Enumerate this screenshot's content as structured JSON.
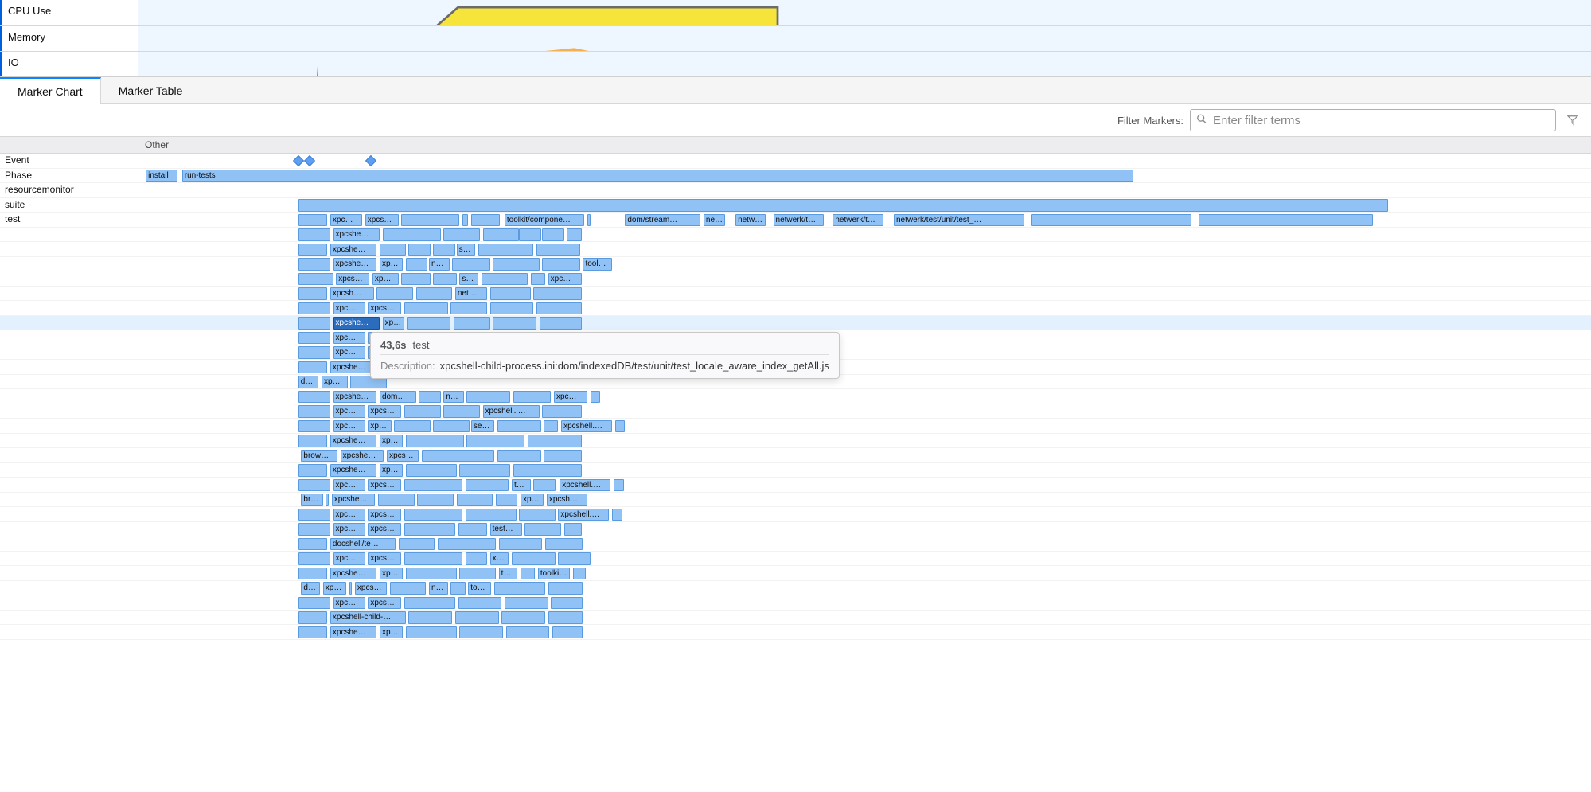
{
  "overview": {
    "tracks": [
      {
        "label": "CPU Use",
        "color_fill": "#f7e43a",
        "color_line": "#6b6b6b"
      },
      {
        "label": "Memory",
        "color_fill": "#f7a93a",
        "color_line": "#d47c00"
      },
      {
        "label": "IO",
        "color_fill": "#e83c5a",
        "color_line": "#c41e3a"
      }
    ]
  },
  "tabs": [
    {
      "label": "Marker Chart",
      "active": true
    },
    {
      "label": "Marker Table",
      "active": false
    }
  ],
  "filter": {
    "label": "Filter Markers:",
    "placeholder": "Enter filter terms"
  },
  "columns": {
    "other": "Other"
  },
  "rows": [
    {
      "label": "Event",
      "kind": "diamonds",
      "diamonds": [
        11.0,
        11.8,
        16.0
      ]
    },
    {
      "label": "Phase",
      "kind": "markers",
      "markers": [
        {
          "l": 0.5,
          "w": 2.2,
          "text": "install"
        },
        {
          "l": 3.0,
          "w": 65.5,
          "text": "run-tests"
        }
      ]
    },
    {
      "label": "resourcemonitor",
      "kind": "markers",
      "markers": []
    },
    {
      "label": "suite",
      "kind": "markers",
      "markers": [
        {
          "l": 11.0,
          "w": 75.0,
          "text": ""
        }
      ]
    },
    {
      "label": "test",
      "kind": "markers",
      "markers": [
        {
          "l": 11.0,
          "w": 2.0,
          "text": ""
        },
        {
          "l": 13.2,
          "w": 2.2,
          "text": "xpc…"
        },
        {
          "l": 15.6,
          "w": 2.3,
          "text": "xpcs…"
        },
        {
          "l": 18.1,
          "w": 4.0,
          "text": ""
        },
        {
          "l": 22.3,
          "w": 0.4,
          "text": ""
        },
        {
          "l": 22.9,
          "w": 2.0,
          "text": ""
        },
        {
          "l": 25.2,
          "w": 5.5,
          "text": "toolkit/compone…"
        },
        {
          "l": 30.9,
          "w": 0.2,
          "text": ""
        },
        {
          "l": 33.5,
          "w": 5.2,
          "text": "dom/stream…"
        },
        {
          "l": 38.9,
          "w": 1.5,
          "text": "ne…"
        },
        {
          "l": 41.1,
          "w": 2.1,
          "text": "netw…"
        },
        {
          "l": 43.7,
          "w": 3.5,
          "text": "netwerk/t…"
        },
        {
          "l": 47.8,
          "w": 3.5,
          "text": "netwerk/t…"
        },
        {
          "l": 52.0,
          "w": 9.0,
          "text": "netwerk/test/unit/test_…"
        },
        {
          "l": 61.5,
          "w": 11.0,
          "text": ""
        },
        {
          "l": 73.0,
          "w": 12.0,
          "text": ""
        }
      ]
    }
  ],
  "test_stack": [
    [
      {
        "l": 11.0,
        "w": 2.2,
        "text": ""
      },
      {
        "l": 13.4,
        "w": 3.2,
        "text": "xpcshe…"
      },
      {
        "l": 16.8,
        "w": 4.0,
        "text": ""
      },
      {
        "l": 21.0,
        "w": 2.5,
        "text": ""
      },
      {
        "l": 23.7,
        "w": 2.5,
        "text": ""
      },
      {
        "l": 26.2,
        "w": 1.5,
        "text": ""
      },
      {
        "l": 27.8,
        "w": 1.5,
        "text": ""
      },
      {
        "l": 29.5,
        "w": 1.0,
        "text": ""
      }
    ],
    [
      {
        "l": 11.0,
        "w": 2.0,
        "text": ""
      },
      {
        "l": 13.2,
        "w": 3.2,
        "text": "xpcshe…"
      },
      {
        "l": 16.6,
        "w": 1.8,
        "text": ""
      },
      {
        "l": 18.6,
        "w": 1.5,
        "text": ""
      },
      {
        "l": 20.3,
        "w": 1.5,
        "text": ""
      },
      {
        "l": 21.9,
        "w": 1.3,
        "text": "s…"
      },
      {
        "l": 23.4,
        "w": 3.8,
        "text": ""
      },
      {
        "l": 27.4,
        "w": 3.0,
        "text": ""
      }
    ],
    [
      {
        "l": 11.0,
        "w": 2.2,
        "text": ""
      },
      {
        "l": 13.4,
        "w": 3.0,
        "text": "xpcshe…"
      },
      {
        "l": 16.6,
        "w": 1.6,
        "text": "xp…"
      },
      {
        "l": 18.4,
        "w": 1.5,
        "text": ""
      },
      {
        "l": 20.0,
        "w": 1.4,
        "text": "n…"
      },
      {
        "l": 21.6,
        "w": 2.6,
        "text": ""
      },
      {
        "l": 24.4,
        "w": 3.2,
        "text": ""
      },
      {
        "l": 27.8,
        "w": 2.6,
        "text": ""
      },
      {
        "l": 30.6,
        "w": 2.0,
        "text": "tool…"
      }
    ],
    [
      {
        "l": 11.0,
        "w": 2.4,
        "text": ""
      },
      {
        "l": 13.6,
        "w": 2.3,
        "text": "xpcs…"
      },
      {
        "l": 16.1,
        "w": 1.8,
        "text": "xp…"
      },
      {
        "l": 18.1,
        "w": 2.0,
        "text": ""
      },
      {
        "l": 20.3,
        "w": 1.6,
        "text": ""
      },
      {
        "l": 22.1,
        "w": 1.3,
        "text": "s…"
      },
      {
        "l": 23.6,
        "w": 3.2,
        "text": ""
      },
      {
        "l": 27.0,
        "w": 1.0,
        "text": ""
      },
      {
        "l": 28.2,
        "w": 2.3,
        "text": "xpc…"
      }
    ],
    [
      {
        "l": 11.0,
        "w": 2.0,
        "text": ""
      },
      {
        "l": 13.2,
        "w": 3.0,
        "text": "xpcsh…"
      },
      {
        "l": 16.4,
        "w": 2.5,
        "text": ""
      },
      {
        "l": 19.1,
        "w": 2.5,
        "text": ""
      },
      {
        "l": 21.8,
        "w": 2.2,
        "text": "net…"
      },
      {
        "l": 24.2,
        "w": 2.8,
        "text": ""
      },
      {
        "l": 27.2,
        "w": 3.3,
        "text": ""
      }
    ],
    [
      {
        "l": 11.0,
        "w": 2.2,
        "text": ""
      },
      {
        "l": 13.4,
        "w": 2.2,
        "text": "xpc…"
      },
      {
        "l": 15.8,
        "w": 2.3,
        "text": "xpcs…"
      },
      {
        "l": 18.3,
        "w": 3.0,
        "text": ""
      },
      {
        "l": 21.5,
        "w": 2.5,
        "text": ""
      },
      {
        "l": 24.2,
        "w": 3.0,
        "text": ""
      },
      {
        "l": 27.4,
        "w": 3.1,
        "text": ""
      }
    ],
    [
      {
        "l": 11.0,
        "w": 2.2,
        "text": ""
      },
      {
        "l": 13.4,
        "w": 3.2,
        "text": "xpcshe…",
        "selected": true
      },
      {
        "l": 16.8,
        "w": 1.5,
        "text": "xp…"
      },
      {
        "l": 18.5,
        "w": 3.0,
        "text": ""
      },
      {
        "l": 21.7,
        "w": 2.5,
        "text": ""
      },
      {
        "l": 24.4,
        "w": 3.0,
        "text": ""
      },
      {
        "l": 27.6,
        "w": 2.9,
        "text": ""
      }
    ],
    [
      {
        "l": 11.0,
        "w": 2.2,
        "text": ""
      },
      {
        "l": 13.4,
        "w": 2.2,
        "text": "xpc…"
      },
      {
        "l": 15.8,
        "w": 2.5,
        "text": ""
      }
    ],
    [
      {
        "l": 11.0,
        "w": 2.2,
        "text": ""
      },
      {
        "l": 13.4,
        "w": 2.2,
        "text": "xpc…"
      },
      {
        "l": 15.8,
        "w": 2.5,
        "text": ""
      }
    ],
    [
      {
        "l": 11.0,
        "w": 2.0,
        "text": ""
      },
      {
        "l": 13.2,
        "w": 3.2,
        "text": "xpcshe…"
      },
      {
        "l": 16.6,
        "w": 1.5,
        "text": ""
      }
    ],
    [
      {
        "l": 11.0,
        "w": 1.4,
        "text": "d…"
      },
      {
        "l": 12.6,
        "w": 1.8,
        "text": "xp…"
      },
      {
        "l": 14.6,
        "w": 2.5,
        "text": ""
      }
    ],
    [
      {
        "l": 11.0,
        "w": 2.2,
        "text": ""
      },
      {
        "l": 13.4,
        "w": 3.0,
        "text": "xpcshe…"
      },
      {
        "l": 16.6,
        "w": 2.5,
        "text": "dom…"
      },
      {
        "l": 19.3,
        "w": 1.5,
        "text": ""
      },
      {
        "l": 21.0,
        "w": 1.4,
        "text": "n…"
      },
      {
        "l": 22.6,
        "w": 3.0,
        "text": ""
      },
      {
        "l": 25.8,
        "w": 2.6,
        "text": ""
      },
      {
        "l": 28.6,
        "w": 2.3,
        "text": "xpc…"
      },
      {
        "l": 31.1,
        "w": 0.7,
        "text": ""
      }
    ],
    [
      {
        "l": 11.0,
        "w": 2.2,
        "text": ""
      },
      {
        "l": 13.4,
        "w": 2.2,
        "text": "xpc…"
      },
      {
        "l": 15.8,
        "w": 2.3,
        "text": "xpcs…"
      },
      {
        "l": 18.3,
        "w": 2.5,
        "text": ""
      },
      {
        "l": 21.0,
        "w": 2.5,
        "text": ""
      },
      {
        "l": 23.7,
        "w": 3.9,
        "text": "xpcshell.i…"
      },
      {
        "l": 27.8,
        "w": 2.7,
        "text": ""
      }
    ],
    [
      {
        "l": 11.0,
        "w": 2.2,
        "text": ""
      },
      {
        "l": 13.4,
        "w": 2.2,
        "text": "xpc…"
      },
      {
        "l": 15.8,
        "w": 1.6,
        "text": "xp…"
      },
      {
        "l": 17.6,
        "w": 2.5,
        "text": ""
      },
      {
        "l": 20.3,
        "w": 2.5,
        "text": ""
      },
      {
        "l": 22.9,
        "w": 1.6,
        "text": "se…"
      },
      {
        "l": 24.7,
        "w": 3.0,
        "text": ""
      },
      {
        "l": 27.9,
        "w": 1.0,
        "text": ""
      },
      {
        "l": 29.1,
        "w": 3.5,
        "text": "xpcshell.…"
      },
      {
        "l": 32.8,
        "w": 0.7,
        "text": ""
      }
    ],
    [
      {
        "l": 11.0,
        "w": 2.0,
        "text": ""
      },
      {
        "l": 13.2,
        "w": 3.2,
        "text": "xpcshe…"
      },
      {
        "l": 16.6,
        "w": 1.6,
        "text": "xp…"
      },
      {
        "l": 18.4,
        "w": 4.0,
        "text": ""
      },
      {
        "l": 22.6,
        "w": 4.0,
        "text": ""
      },
      {
        "l": 26.8,
        "w": 3.7,
        "text": ""
      }
    ],
    [
      {
        "l": 11.2,
        "w": 2.5,
        "text": "brow…"
      },
      {
        "l": 13.9,
        "w": 3.0,
        "text": "xpcshe…"
      },
      {
        "l": 17.1,
        "w": 2.2,
        "text": "xpcs…"
      },
      {
        "l": 19.5,
        "w": 5.0,
        "text": ""
      },
      {
        "l": 24.7,
        "w": 3.0,
        "text": ""
      },
      {
        "l": 27.9,
        "w": 2.6,
        "text": ""
      }
    ],
    [
      {
        "l": 11.0,
        "w": 2.0,
        "text": ""
      },
      {
        "l": 13.2,
        "w": 3.2,
        "text": "xpcshe…"
      },
      {
        "l": 16.6,
        "w": 1.6,
        "text": "xp…"
      },
      {
        "l": 18.4,
        "w": 3.5,
        "text": ""
      },
      {
        "l": 22.1,
        "w": 3.5,
        "text": ""
      },
      {
        "l": 25.8,
        "w": 4.7,
        "text": ""
      }
    ],
    [
      {
        "l": 11.0,
        "w": 2.2,
        "text": ""
      },
      {
        "l": 13.4,
        "w": 2.2,
        "text": "xpc…"
      },
      {
        "l": 15.8,
        "w": 2.3,
        "text": "xpcs…"
      },
      {
        "l": 18.3,
        "w": 4.0,
        "text": ""
      },
      {
        "l": 22.5,
        "w": 3.0,
        "text": ""
      },
      {
        "l": 25.7,
        "w": 1.3,
        "text": "t…"
      },
      {
        "l": 27.2,
        "w": 1.5,
        "text": ""
      },
      {
        "l": 29.0,
        "w": 3.5,
        "text": "xpcshell.…"
      },
      {
        "l": 32.7,
        "w": 0.7,
        "text": ""
      }
    ],
    [
      {
        "l": 11.2,
        "w": 1.5,
        "text": "br…"
      },
      {
        "l": 12.9,
        "w": 0.2,
        "text": ""
      },
      {
        "l": 13.3,
        "w": 3.0,
        "text": "xpcshe…"
      },
      {
        "l": 16.5,
        "w": 2.5,
        "text": ""
      },
      {
        "l": 19.2,
        "w": 2.5,
        "text": ""
      },
      {
        "l": 21.9,
        "w": 2.5,
        "text": ""
      },
      {
        "l": 24.6,
        "w": 1.5,
        "text": ""
      },
      {
        "l": 26.3,
        "w": 1.6,
        "text": "xp…"
      },
      {
        "l": 28.1,
        "w": 2.8,
        "text": "xpcsh…"
      }
    ],
    [
      {
        "l": 11.0,
        "w": 2.2,
        "text": ""
      },
      {
        "l": 13.4,
        "w": 2.2,
        "text": "xpc…"
      },
      {
        "l": 15.8,
        "w": 2.3,
        "text": "xpcs…"
      },
      {
        "l": 18.3,
        "w": 4.0,
        "text": ""
      },
      {
        "l": 22.5,
        "w": 3.5,
        "text": ""
      },
      {
        "l": 26.2,
        "w": 2.5,
        "text": ""
      },
      {
        "l": 28.9,
        "w": 3.5,
        "text": "xpcshell.…"
      },
      {
        "l": 32.6,
        "w": 0.7,
        "text": ""
      }
    ],
    [
      {
        "l": 11.0,
        "w": 2.2,
        "text": ""
      },
      {
        "l": 13.4,
        "w": 2.2,
        "text": "xpc…"
      },
      {
        "l": 15.8,
        "w": 2.3,
        "text": "xpcs…"
      },
      {
        "l": 18.3,
        "w": 3.5,
        "text": ""
      },
      {
        "l": 22.0,
        "w": 2.0,
        "text": ""
      },
      {
        "l": 24.2,
        "w": 2.2,
        "text": "test…"
      },
      {
        "l": 26.6,
        "w": 2.5,
        "text": ""
      },
      {
        "l": 29.3,
        "w": 1.2,
        "text": ""
      }
    ],
    [
      {
        "l": 11.0,
        "w": 2.0,
        "text": ""
      },
      {
        "l": 13.2,
        "w": 4.5,
        "text": "docshell/te…"
      },
      {
        "l": 17.9,
        "w": 2.5,
        "text": ""
      },
      {
        "l": 20.6,
        "w": 4.0,
        "text": ""
      },
      {
        "l": 24.8,
        "w": 3.0,
        "text": ""
      },
      {
        "l": 28.0,
        "w": 2.6,
        "text": ""
      }
    ],
    [
      {
        "l": 11.0,
        "w": 2.2,
        "text": ""
      },
      {
        "l": 13.4,
        "w": 2.2,
        "text": "xpc…"
      },
      {
        "l": 15.8,
        "w": 2.3,
        "text": "xpcs…"
      },
      {
        "l": 18.3,
        "w": 4.0,
        "text": ""
      },
      {
        "l": 22.5,
        "w": 1.5,
        "text": ""
      },
      {
        "l": 24.2,
        "w": 1.3,
        "text": "x…"
      },
      {
        "l": 25.7,
        "w": 3.0,
        "text": ""
      },
      {
        "l": 28.9,
        "w": 2.2,
        "text": ""
      }
    ],
    [
      {
        "l": 11.0,
        "w": 2.0,
        "text": ""
      },
      {
        "l": 13.2,
        "w": 3.2,
        "text": "xpcshe…"
      },
      {
        "l": 16.6,
        "w": 1.6,
        "text": "xp…"
      },
      {
        "l": 18.4,
        "w": 3.5,
        "text": ""
      },
      {
        "l": 22.1,
        "w": 2.5,
        "text": ""
      },
      {
        "l": 24.8,
        "w": 1.3,
        "text": "t…"
      },
      {
        "l": 26.3,
        "w": 1.0,
        "text": ""
      },
      {
        "l": 27.5,
        "w": 2.2,
        "text": "toolki…"
      },
      {
        "l": 29.9,
        "w": 0.9,
        "text": ""
      }
    ],
    [
      {
        "l": 11.2,
        "w": 1.3,
        "text": "d…"
      },
      {
        "l": 12.7,
        "w": 1.6,
        "text": "xp…"
      },
      {
        "l": 14.5,
        "w": 0.2,
        "text": ""
      },
      {
        "l": 14.9,
        "w": 2.2,
        "text": "xpcs…"
      },
      {
        "l": 17.3,
        "w": 2.5,
        "text": ""
      },
      {
        "l": 20.0,
        "w": 1.3,
        "text": "n…"
      },
      {
        "l": 21.5,
        "w": 1.0,
        "text": ""
      },
      {
        "l": 22.7,
        "w": 1.6,
        "text": "too…"
      },
      {
        "l": 24.5,
        "w": 3.5,
        "text": ""
      },
      {
        "l": 28.2,
        "w": 2.4,
        "text": ""
      }
    ],
    [
      {
        "l": 11.0,
        "w": 2.2,
        "text": ""
      },
      {
        "l": 13.4,
        "w": 2.2,
        "text": "xpc…"
      },
      {
        "l": 15.8,
        "w": 2.3,
        "text": "xpcs…"
      },
      {
        "l": 18.3,
        "w": 3.5,
        "text": ""
      },
      {
        "l": 22.0,
        "w": 3.0,
        "text": ""
      },
      {
        "l": 25.2,
        "w": 3.0,
        "text": ""
      },
      {
        "l": 28.4,
        "w": 2.2,
        "text": ""
      }
    ],
    [
      {
        "l": 11.0,
        "w": 2.0,
        "text": ""
      },
      {
        "l": 13.2,
        "w": 5.2,
        "text": "xpcshell-child-…"
      },
      {
        "l": 18.6,
        "w": 3.0,
        "text": ""
      },
      {
        "l": 21.8,
        "w": 3.0,
        "text": ""
      },
      {
        "l": 25.0,
        "w": 3.0,
        "text": ""
      },
      {
        "l": 28.2,
        "w": 2.4,
        "text": ""
      }
    ],
    [
      {
        "l": 11.0,
        "w": 2.0,
        "text": ""
      },
      {
        "l": 13.2,
        "w": 3.2,
        "text": "xpcshe…"
      },
      {
        "l": 16.6,
        "w": 1.6,
        "text": "xp…"
      },
      {
        "l": 18.4,
        "w": 3.5,
        "text": ""
      },
      {
        "l": 22.1,
        "w": 3.0,
        "text": ""
      },
      {
        "l": 25.3,
        "w": 3.0,
        "text": ""
      },
      {
        "l": 28.5,
        "w": 2.1,
        "text": ""
      }
    ]
  ],
  "tooltip": {
    "duration": "43,6s",
    "name": "test",
    "desc_label": "Description:",
    "desc_value": "xpcshell-child-process.ini:dom/indexedDB/test/unit/test_locale_aware_index_getAll.js"
  }
}
